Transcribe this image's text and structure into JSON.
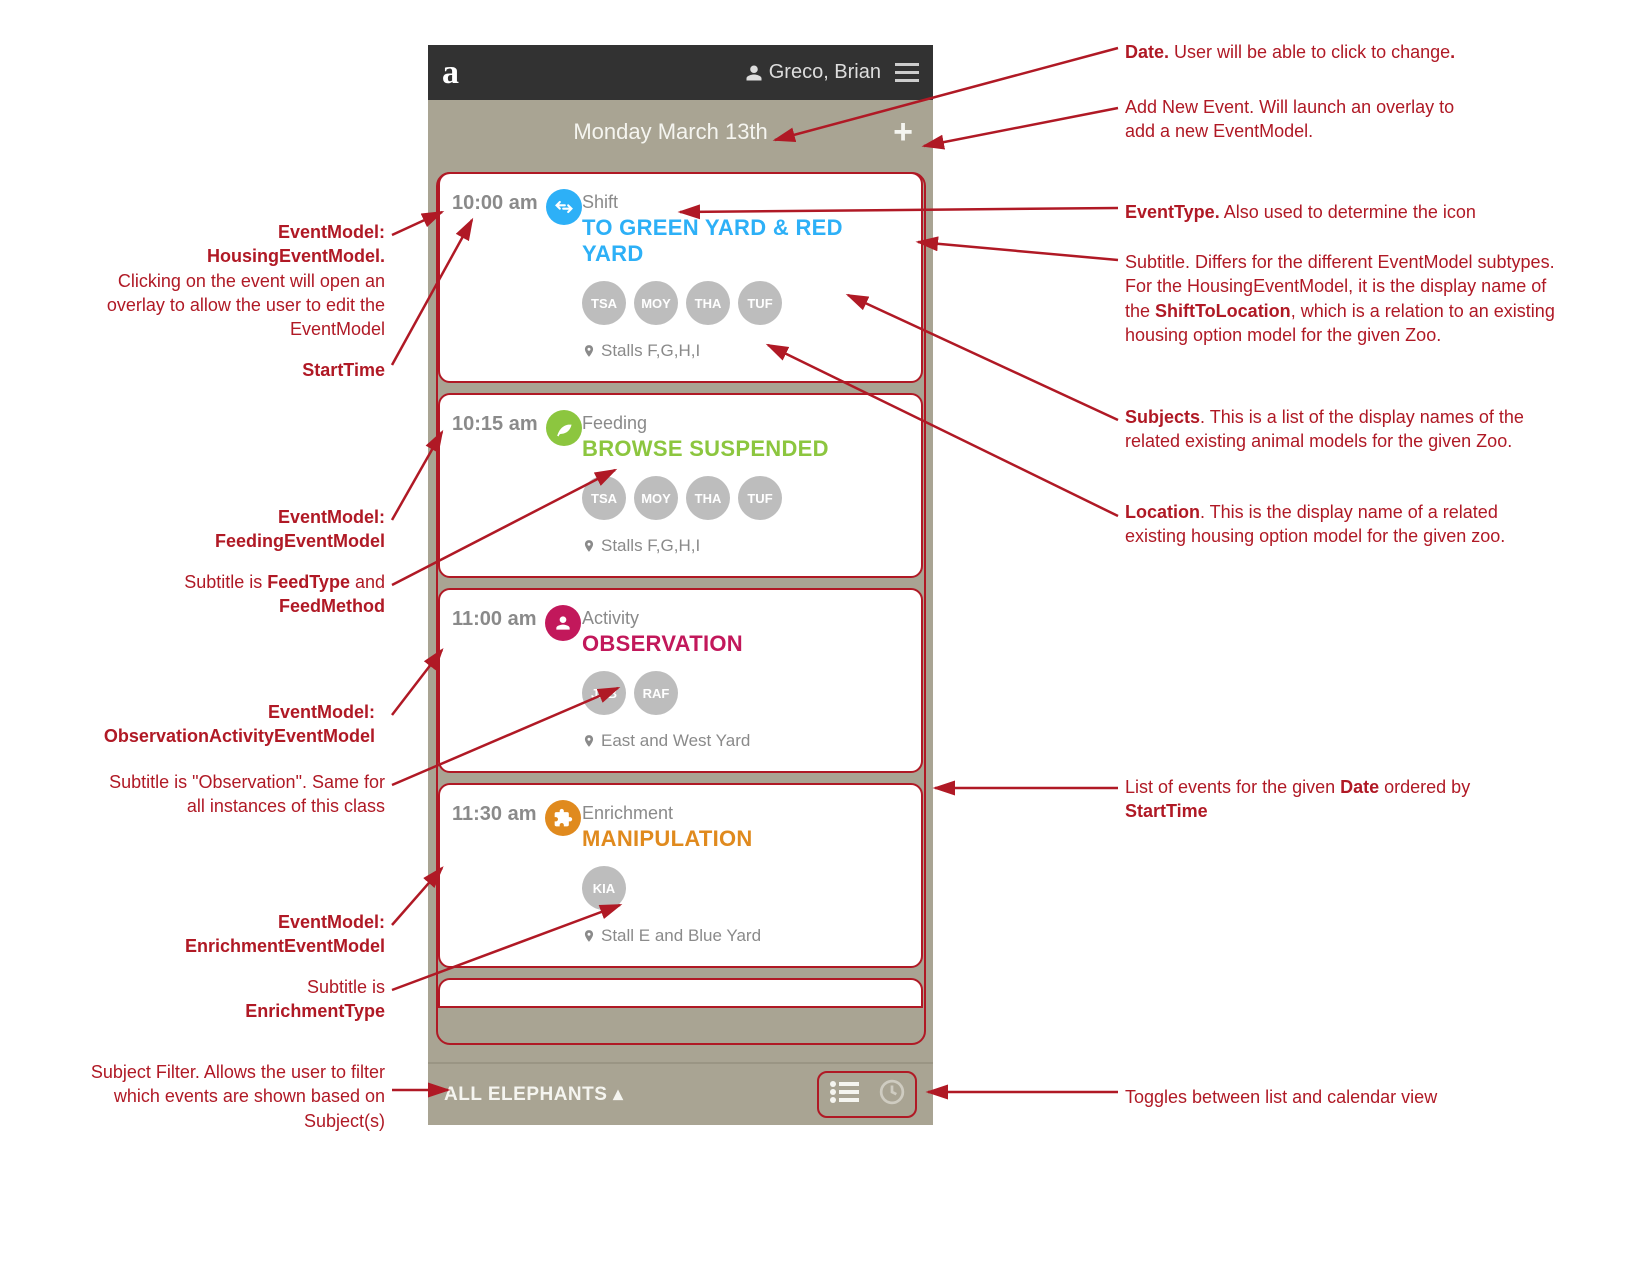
{
  "header": {
    "logo": "a",
    "user_name": "Greco, Brian"
  },
  "dateBar": {
    "date_label": "Monday March 13th"
  },
  "events": [
    {
      "time": "10:00 am",
      "color": "blue",
      "type": "Shift",
      "subtitle": "TO GREEN YARD & RED YARD",
      "subjects": [
        "TSA",
        "MOY",
        "THA",
        "TUF"
      ],
      "location": "Stalls F,G,H,I"
    },
    {
      "time": "10:15 am",
      "color": "green",
      "type": "Feeding",
      "subtitle": "BROWSE SUSPENDED",
      "subjects": [
        "TSA",
        "MOY",
        "THA",
        "TUF"
      ],
      "location": "Stalls F,G,H,I"
    },
    {
      "time": "11:00 am",
      "color": "magenta",
      "type": "Activity",
      "subtitle": "OBSERVATION",
      "subjects": [
        "JAB",
        "RAF"
      ],
      "location": "East and West Yard"
    },
    {
      "time": "11:30 am",
      "color": "orange",
      "type": "Enrichment",
      "subtitle": "MANIPULATION",
      "subjects": [
        "KIA"
      ],
      "location": "Stall E and Blue Yard"
    }
  ],
  "bottomBar": {
    "filter_label": "ALL ELEPHANTS"
  },
  "annotations": {
    "date": "Date. User will be able to click to change.",
    "addEvent": "Add New Event. Will launch an overlay to add a new EventModel.",
    "eventType": "EventType. Also used to determine the icon",
    "subtitle": "Subtitle. Differs for the different EventModel subtypes. For the HousingEventModel, it is the display name of the ShiftToLocation, which is a relation to an existing housing option model for the given Zoo.",
    "subjects": "Subjects. This is a list of the display names of the related existing animal models for the given Zoo.",
    "location": "Location. This is the display name of a related existing housing option model for the given zoo.",
    "listEvents": "List of events for the given Date ordered by StartTime",
    "toggles": "Toggles between list and calendar view",
    "housingModel_l1": "EventModel:",
    "housingModel_l2": "HousingEventModel.",
    "housingModel_l3": "Clicking on the event will open an overlay to allow the user to edit the EventModel",
    "startTime": "StartTime",
    "feedingModel_l1": "EventModel:",
    "feedingModel_l2": "FeedingEventModel",
    "feedingSubtitle_l1": "Subtitle is FeedType and",
    "feedingSubtitle_l2": "FeedMethod",
    "obsModel_l1": "EventModel:",
    "obsModel_l2": "ObservationActivityEventModel",
    "obsSubtitle": "Subtitle is “Observation”. Same for all instances of this class",
    "enrichModel_l1": "EventModel:",
    "enrichModel_l2": "EnrichmentEventModel",
    "enrichSubtitle_l1": "Subtitle is",
    "enrichSubtitle_l2": "EnrichmentType",
    "subjectFilter": "Subject Filter. Allows the user to filter which events are shown based on Subject(s)"
  }
}
